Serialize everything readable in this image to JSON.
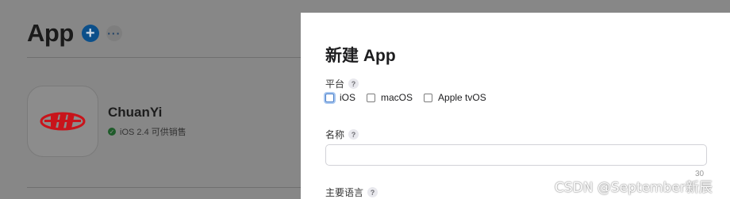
{
  "background": {
    "title": "App",
    "add_icon": "plus-circle-icon",
    "more_icon": "ellipsis-icon",
    "app": {
      "name": "ChuanYi",
      "status": "iOS 2.4 可供销售",
      "status_color": "#1e5b2a"
    }
  },
  "modal": {
    "title": "新建 App",
    "platform_label": "平台",
    "platforms": [
      "iOS",
      "macOS",
      "Apple tvOS"
    ],
    "name_label": "名称",
    "name_value": "",
    "name_count": "30",
    "language_label": "主要语言",
    "help_symbol": "?"
  },
  "watermark": "CSDN @September新辰",
  "colors": {
    "accent": "#0b4f8a",
    "logo_red": "#c8141b"
  }
}
